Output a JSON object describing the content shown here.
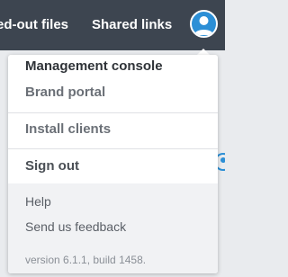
{
  "topbar": {
    "tab_checked_out": "ed-out files",
    "tab_shared_links": "Shared links",
    "avatar_icon": "user-icon",
    "background_color": "#3d4550",
    "avatar_color": "#2c8fd6"
  },
  "menu": {
    "items": [
      {
        "label": "Management console"
      },
      {
        "label": "Brand portal"
      },
      {
        "label": "Install clients"
      },
      {
        "label": "Sign out"
      }
    ],
    "footer": {
      "help": "Help",
      "feedback": "Send us feedback",
      "version": "version 6.1.1, build 1458."
    }
  }
}
